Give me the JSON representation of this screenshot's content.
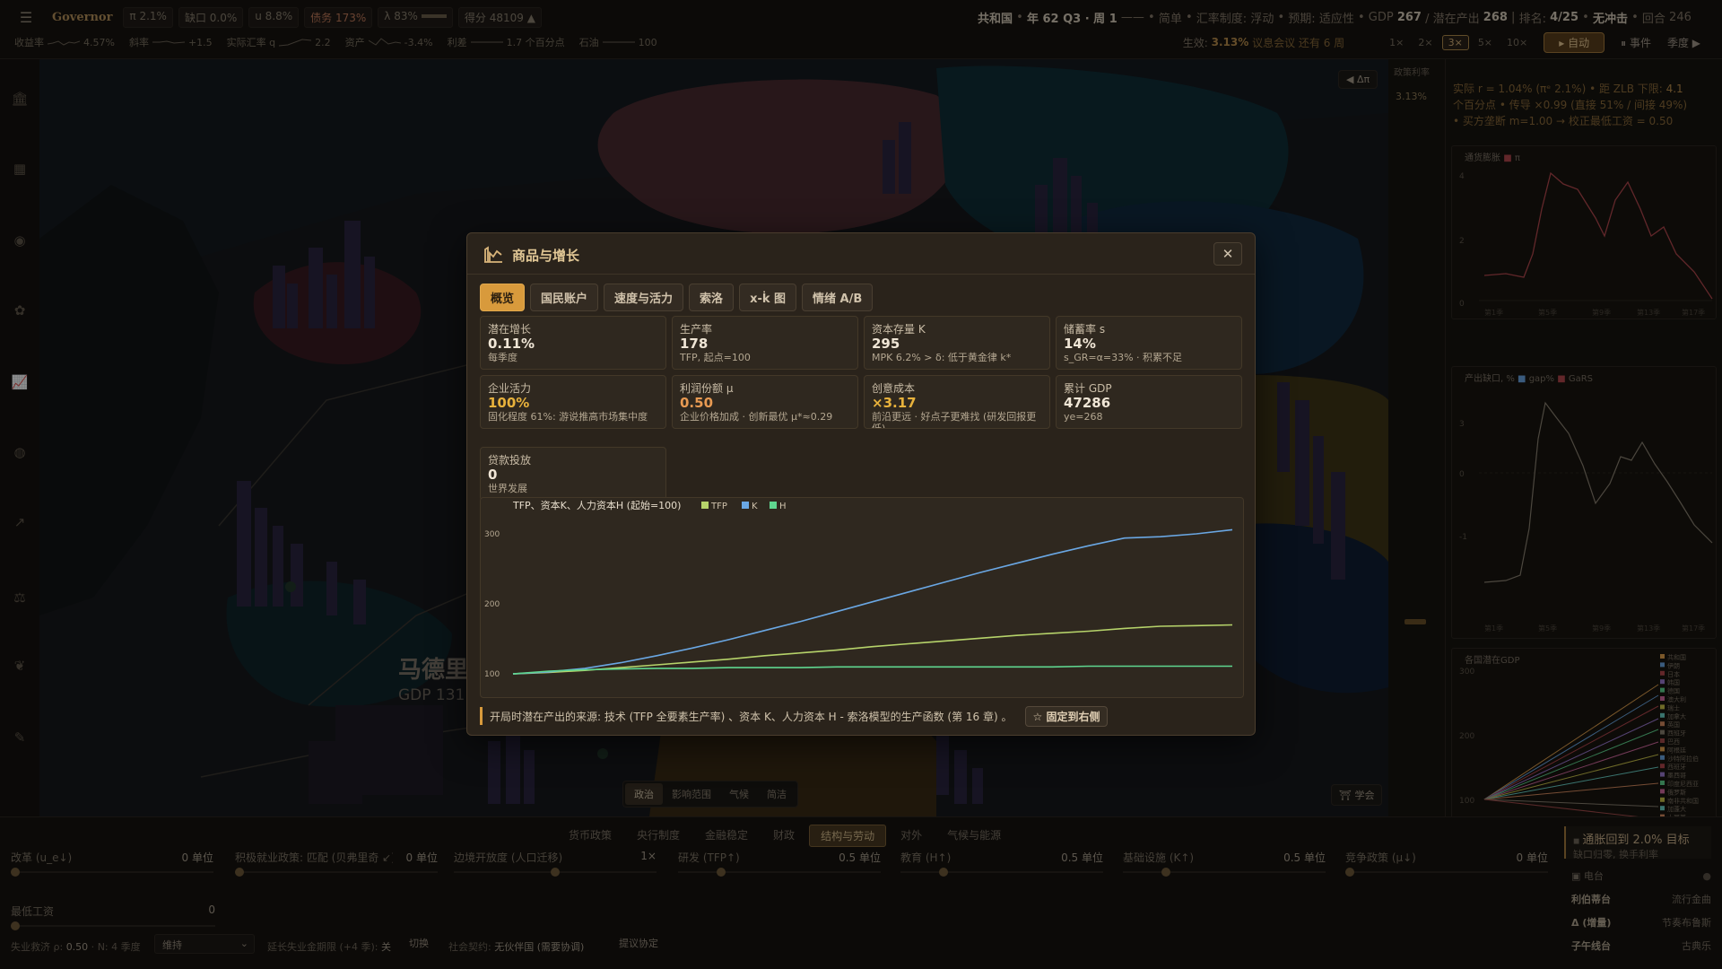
{
  "topbar": {
    "menu_icon": "hamburger-icon",
    "brand": "Governor",
    "chips": [
      {
        "label": "π 2.1%",
        "tone": "normal"
      },
      {
        "label": "缺口 0.0%",
        "tone": "normal"
      },
      {
        "label": "u 8.8%",
        "tone": "normal"
      },
      {
        "label": "债务 173%",
        "tone": "red"
      },
      {
        "label": "λ 83%",
        "tone": "normal"
      },
      {
        "label": "得分 48109 ▲",
        "tone": "normal"
      }
    ],
    "country": "共和国",
    "period": "年 62 Q3 · 周 1",
    "mode": "简单",
    "fx_label": "汇率制度:",
    "fx_value": "浮动",
    "forecast_label": "预期:",
    "forecast_value": "适应性",
    "gdp_label": "GDP",
    "gdp_value": "267",
    "potential_label": "/ 潜在产出",
    "potential_value": "268",
    "rank_label": "排名:",
    "rank_value": "4/25",
    "shock": "无冲击",
    "round_label": "回合",
    "round_value": "246",
    "sparks": [
      {
        "label": "收益率",
        "value": "4.57%"
      },
      {
        "label": "斜率",
        "value": "+1.5"
      },
      {
        "label": "实际汇率 q",
        "value": "2.2"
      },
      {
        "label": "资产",
        "value": "-3.4%"
      },
      {
        "label": "利差",
        "value": "1.7 个百分点"
      },
      {
        "label": "石油",
        "value": "100"
      }
    ],
    "effective_label": "生效:",
    "effective_value": "3.13%",
    "meeting_note": "议息会议 还有 6 周",
    "speeds": [
      "1×",
      "2×",
      "3×",
      "5×",
      "10×"
    ],
    "speed_active": "3×",
    "auto_label": "自动",
    "events_label": "事件",
    "season_label": "季度 ▶"
  },
  "rail_icons": [
    "bank-icon",
    "factory-icon",
    "coins-icon",
    "sprout-icon",
    "chart-line-icon",
    "globe-icon",
    "trend-icon",
    "scale-icon",
    "leaf-icon",
    "notes-icon"
  ],
  "map": {
    "delta_button": "◀ Δπ",
    "city_name": "马德里",
    "city_sub": "GDP 131 · π -1.7%",
    "learn_button": "学会",
    "tabs": [
      "政治",
      "影响范围",
      "气候",
      "简洁"
    ],
    "tab_active": "政治"
  },
  "right_panel": {
    "policy_label": "政策利率",
    "policy_value": "3.13%",
    "info_line1": "实际 r = 1.04% (πᵉ 2.1%) • 距 ZLB 下限:",
    "info_line1b": "4.1",
    "info_line2": "个百分点 • 传导 ×0.99 (直接 51% / 间接 49%)",
    "info_line3": "• 买方垄断 m=1.00 → 校正最低工资 = 0.50",
    "chart1_title": "通货膨胀",
    "chart1_legend": "π",
    "chart1_yticks": [
      "4",
      "2",
      "0"
    ],
    "chart2_title": "产出缺口, %",
    "chart2_legend_a": "gap%",
    "chart2_legend_b": "GaRS",
    "chart2_yticks": [
      "3",
      "0",
      "-1"
    ],
    "chart3_title": "各国潜在GDP",
    "chart3_yticks": [
      "300",
      "200",
      "100"
    ],
    "chart3_countries": [
      "共和国",
      "伊朗",
      "日本",
      "韩国",
      "德国",
      "澳大利",
      "瑞士",
      "加拿大",
      "英国",
      "西班牙",
      "巴西",
      "阿根廷",
      "沙特阿拉伯",
      "西班牙",
      "墨西哥",
      "印度尼西亚",
      "俄罗斯",
      "南非共和国",
      "加蓬大",
      "土耳其",
      "印度",
      "澳大利亚"
    ],
    "xticks": [
      "第1季",
      "第5季",
      "第9季",
      "第13季",
      "第17季"
    ]
  },
  "bottom": {
    "tabs": [
      "货币政策",
      "央行制度",
      "金融稳定",
      "财政",
      "结构与劳动",
      "对外",
      "气候与能源"
    ],
    "tab_active": "结构与劳动",
    "sliders": [
      {
        "label": "改革 (u_e↓)",
        "value": "0 单位",
        "pos": 0.0
      },
      {
        "label": "积极就业政策: 匹配 (贝弗里奇 ↙)",
        "value": "0 单位",
        "pos": 0.0
      },
      {
        "label": "边境开放度 (人口迁移)",
        "value": "1×",
        "pos": 0.5
      },
      {
        "label": "研发 (TFP↑)",
        "value": "0.5 单位",
        "pos": 0.2
      },
      {
        "label": "教育 (H↑)",
        "value": "0.5 单位",
        "pos": 0.2
      },
      {
        "label": "基础设施 (K↑)",
        "value": "0.5 单位",
        "pos": 0.2
      },
      {
        "label": "竞争政策 (μ↓)",
        "value": "0 单位",
        "pos": 0.0
      }
    ],
    "min_wage_label": "最低工资",
    "min_wage_value": "0",
    "unemp_label": "失业救济 ρ:",
    "unemp_value": "0.50",
    "n_label": "N: 4 季度",
    "dropdown_value": "维持",
    "extend_label": "延长失业金期限 (+4 季):",
    "extend_value": "关",
    "switch_label": "切换",
    "social_label": "社会契约:",
    "social_value": "无伙伴国 (需要协调)",
    "propose_label": "提议协定",
    "news_title": "通胀回到 2.0% 目标",
    "news_sub": "缺口归零, 换手利率",
    "news_icon": "news-icon",
    "radio_header": "电台",
    "radios": [
      {
        "left": "利伯蒂台",
        "right": "流行金曲",
        "bold": true
      },
      {
        "left": "Δ (增量)",
        "right": "节奏布鲁斯",
        "bold": true
      },
      {
        "left": "子午线台",
        "right": "古典乐",
        "bold": true
      }
    ]
  },
  "modal": {
    "title_icon": "factory-chart-icon",
    "title": "商品与增长",
    "close_icon": "close-icon",
    "tabs": [
      "概览",
      "国民账户",
      "速度与活力",
      "索洛",
      "x-k̇ 图",
      "情绪 A/B"
    ],
    "tab_active": "概览",
    "cards": [
      {
        "label": "潜在增长",
        "value": "0.11%",
        "sub": "每季度",
        "tone": "white"
      },
      {
        "label": "生产率",
        "value": "178",
        "sub": "TFP, 起点=100",
        "tone": "white"
      },
      {
        "label": "资本存量 K",
        "value": "295",
        "sub": "MPK 6.2% > δ: 低于黄金律 k*",
        "tone": "white"
      },
      {
        "label": "储蓄率 s",
        "value": "14%",
        "sub": "s_GR=α=33% · 积累不足",
        "tone": "white"
      },
      {
        "label": "企业活力",
        "value": "100%",
        "sub": "固化程度 61%: 游说推高市场集中度",
        "tone": "gold"
      },
      {
        "label": "利润份额 μ",
        "value": "0.50",
        "sub": "企业价格加成 · 创新最优 μ*≈0.29",
        "tone": "orange"
      },
      {
        "label": "创意成本",
        "value": "×3.17",
        "sub": "前沿更远 · 好点子更难找 (研发回报更低)",
        "tone": "gold"
      },
      {
        "label": "累计 GDP",
        "value": "47286",
        "sub": "ye=268",
        "tone": "white"
      },
      {
        "label": "贷款投放",
        "value": "0",
        "sub": "世界发展",
        "tone": "white"
      }
    ],
    "footer_text": "开局时潜在产出的来源: 技术 (TFP 全要素生产率) 、资本 K、人力资本 H - 索洛模型的生产函数 (第 16 章) 。",
    "pin_label": "☆ 固定到右侧"
  },
  "chart_data": {
    "type": "line",
    "title": "TFP、资本K、人力资本H (起始=100)",
    "x": [
      0,
      1,
      2,
      3,
      4,
      5,
      6,
      7,
      8,
      9,
      10,
      11,
      12,
      13,
      14,
      15,
      16,
      17,
      18,
      19,
      20
    ],
    "series": [
      {
        "name": "TFP",
        "color": "#b6d36a",
        "values": [
          100,
          102,
          105,
          109,
          113,
          117,
          121,
          126,
          130,
          134,
          139,
          143,
          147,
          151,
          155,
          158,
          161,
          165,
          168,
          169,
          170
        ]
      },
      {
        "name": "K",
        "color": "#6aa7e3",
        "values": [
          100,
          103,
          108,
          116,
          126,
          137,
          149,
          162,
          175,
          189,
          203,
          217,
          231,
          245,
          258,
          271,
          283,
          294,
          296,
          300,
          306
        ]
      },
      {
        "name": "H",
        "color": "#5fd68f",
        "values": [
          100,
          104,
          106,
          107,
          108,
          108,
          109,
          109,
          109,
          110,
          110,
          110,
          110,
          110,
          110,
          110,
          111,
          111,
          111,
          111,
          111
        ]
      }
    ],
    "yticks": [
      100,
      200,
      300
    ],
    "ylim": [
      95,
      318
    ],
    "grid": false,
    "legend": "top-left"
  }
}
